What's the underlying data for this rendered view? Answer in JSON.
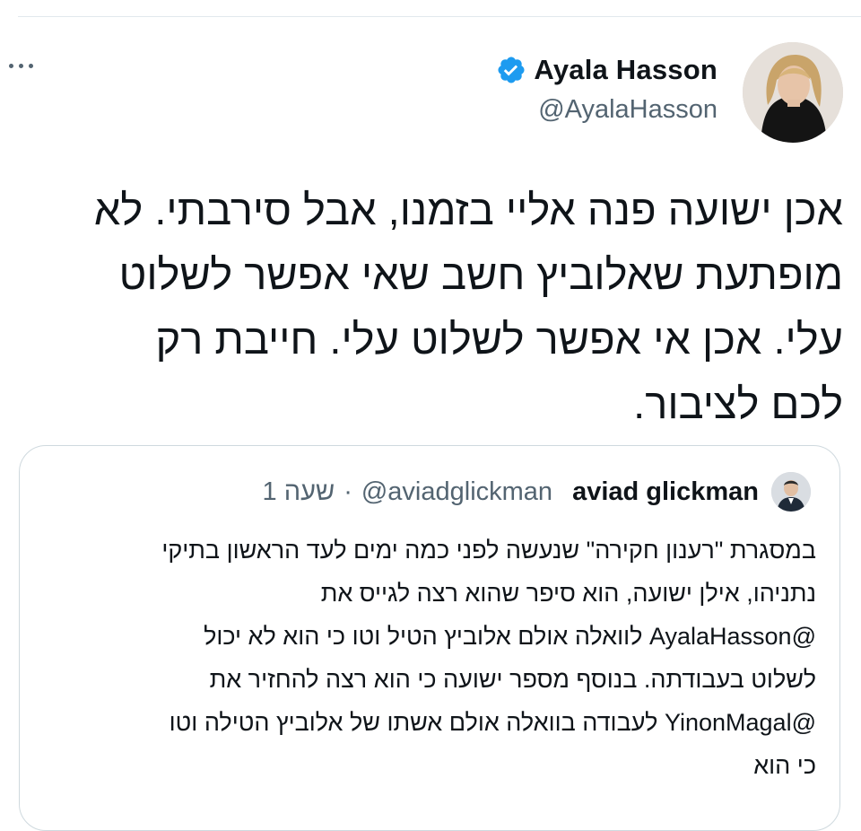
{
  "tweet": {
    "author_name": "Ayala Hasson",
    "author_handle": "@AyalaHasson",
    "verified_icon": "verified-badge-icon",
    "more_icon": "more-dots-icon",
    "text_lines": [
      "אכן ישועה פנה אליי בזמנו, אבל סירבתי. לא",
      "מופתעת שאלוביץ חשב שאי אפשר לשלוט",
      "עלי.  אכן  אי אפשר לשלוט עלי. חייבת רק",
      "לכם לציבור."
    ]
  },
  "quoted_tweet": {
    "author_name": "aviad glickman",
    "author_handle": "@aviadglickman",
    "separator": "·",
    "time": "שעה 1",
    "text_lines": [
      "במסגרת \"רענון חקירה\" שנעשה לפני כמה ימים לעד הראשון בתיקי",
      "נתניהו, אילן ישועה, הוא סיפר שהוא רצה לגייס את",
      "@AyalaHasson לוואלה אולם אלוביץ הטיל וטו כי הוא לא יכול",
      "לשלוט בעבודתה. בנוסף מספר ישועה כי הוא רצה להחזיר את",
      "@YinonMagal לעבודה בוואלה אולם אשתו של אלוביץ הטילה וטו",
      "כי הוא"
    ]
  },
  "colors": {
    "verified_blue": "#1d9bf0",
    "text_primary": "#0f1419",
    "text_secondary": "#536471",
    "border": "#cfd9de"
  }
}
